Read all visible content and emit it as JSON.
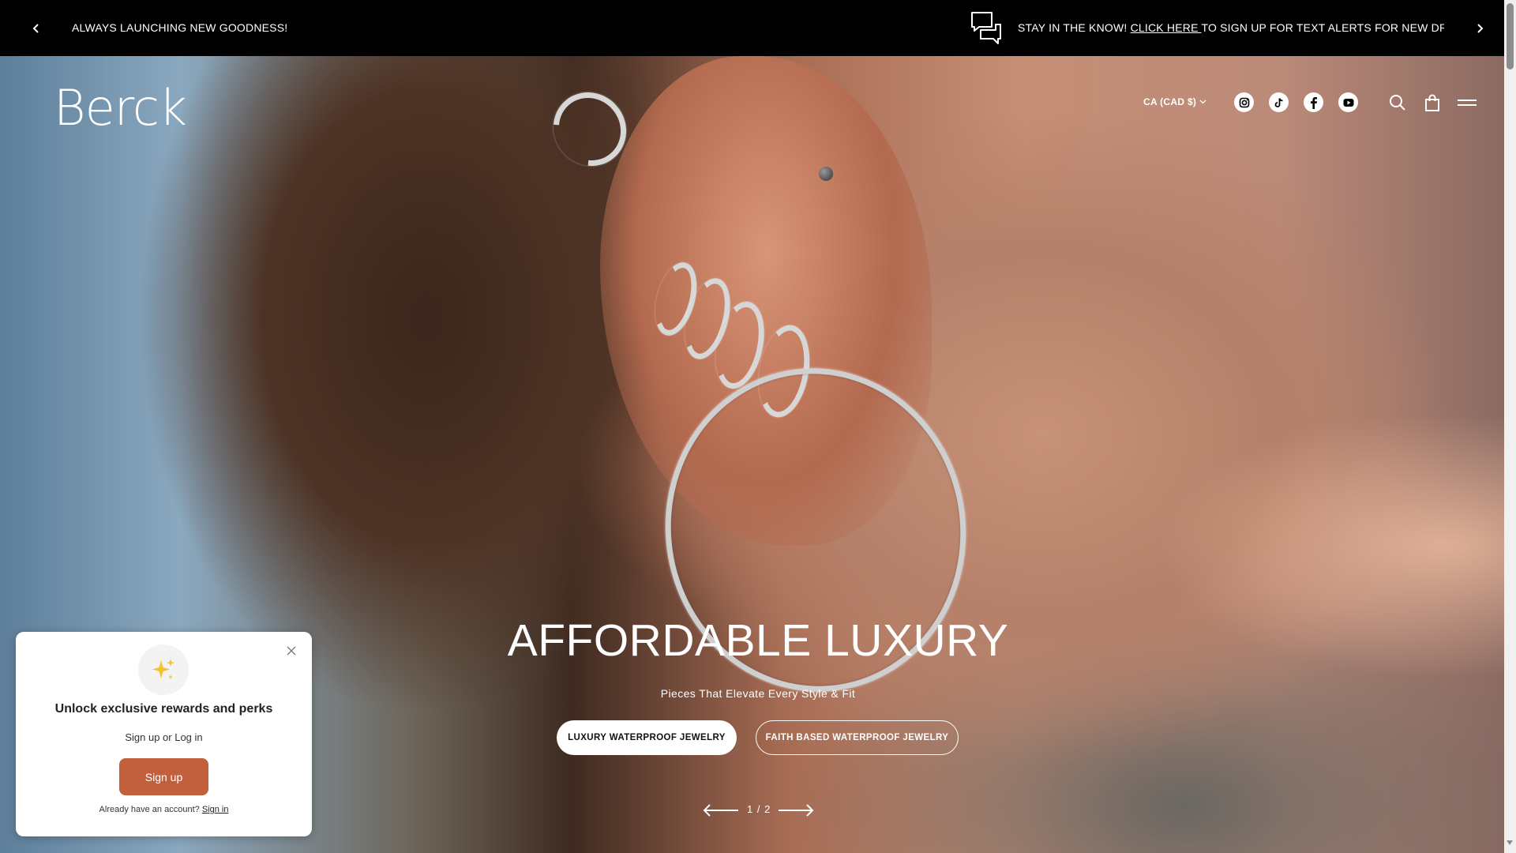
{
  "announcement": {
    "left_message": "ALWAYS LAUNCHING NEW GOODNESS!",
    "right_prefix": "STAY IN THE KNOW! ",
    "right_link": "CLICK HERE ",
    "right_suffix": "TO SIGN UP FOR TEXT ALERTS FOR NEW DROPS, PROM",
    "icons": [
      "chevron-left-icon",
      "chevron-right-icon",
      "chat-bubbles-icon"
    ]
  },
  "header": {
    "logo": "Berck",
    "currency": "CA (CAD $)",
    "social_icons": [
      "instagram-icon",
      "tiktok-icon",
      "facebook-icon",
      "youtube-icon"
    ],
    "action_icons": [
      "search-icon",
      "cart-icon",
      "menu-icon"
    ]
  },
  "hero": {
    "title": "AFFORDABLE LUXURY",
    "subtitle": "Pieces That Elevate Every Style & Fit",
    "buttons": [
      {
        "label": "LUXURY WATERPROOF JEWELRY"
      },
      {
        "label": "FAITH BASED WATERPROOF JEWELRY"
      }
    ],
    "pager": {
      "current": 1,
      "total": 2,
      "label": "1 / 2"
    }
  },
  "rewards_popup": {
    "title": "Unlock exclusive rewards and perks",
    "subtitle": "Sign up or Log in",
    "signup_label": "Sign up",
    "already_text": "Already have an account? ",
    "signin_label": "Sign in",
    "accent_color": "#c2603d"
  }
}
